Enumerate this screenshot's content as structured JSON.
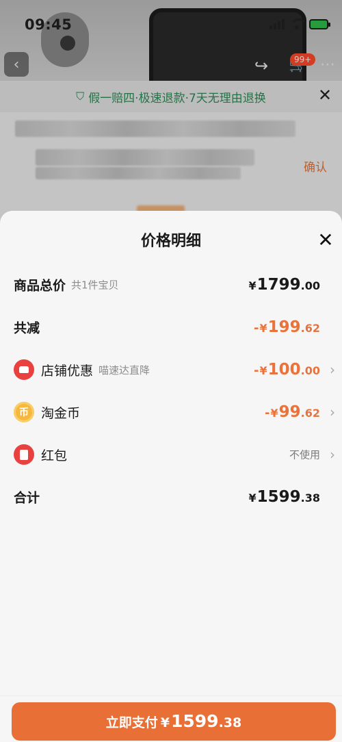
{
  "status_bar": {
    "time": "09:45"
  },
  "background": {
    "cart_badge": "99+",
    "guarantee_text": "假一赔四·极速退款·7天无理由退换",
    "confirm_label": "确认"
  },
  "sheet": {
    "title": "价格明细",
    "rows": [
      {
        "label": "商品总价",
        "note": "共1件宝贝",
        "sign": "",
        "yen": "¥",
        "int": "1799",
        "dec": ".00"
      },
      {
        "label": "共减",
        "sign": "-",
        "yen": "¥",
        "int": "199",
        "dec": ".62"
      },
      {
        "label": "店铺优惠",
        "note": "喵速达直降",
        "icon": "store-coupon-icon",
        "sign": "-",
        "yen": "¥",
        "int": "100",
        "dec": ".00"
      },
      {
        "label": "淘金币",
        "icon": "coin-icon",
        "sign": "-",
        "yen": "¥",
        "int": "99",
        "dec": ".62"
      },
      {
        "label": "红包",
        "icon": "red-packet-icon",
        "value_text": "不使用"
      },
      {
        "label": "合计",
        "sign": "",
        "yen": "¥",
        "int": "1599",
        "dec": ".38"
      }
    ]
  },
  "pay_button": {
    "label": "立即支付",
    "yen": "¥",
    "int": "1599",
    "dec": ".38"
  },
  "colors": {
    "accent": "#e86f35",
    "discount": "#e8733c",
    "guarantee": "#2e8b57"
  }
}
